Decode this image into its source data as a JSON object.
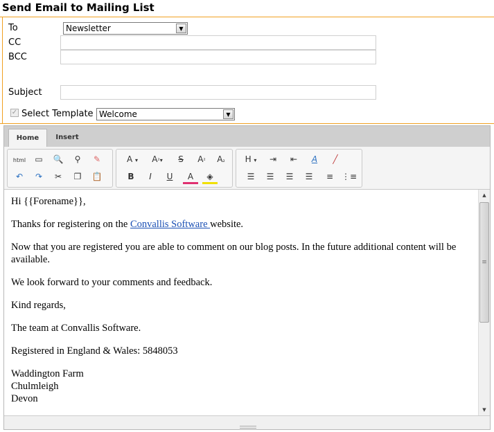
{
  "page": {
    "title": "Send Email to Mailing List"
  },
  "form": {
    "to_label": "To",
    "to_selected": "Newsletter",
    "cc_label": "CC",
    "bcc_label": "BCC",
    "subject_label": "Subject",
    "template_label": "Select Template",
    "template_checked": true,
    "template_selected": "Welcome"
  },
  "editor": {
    "tabs": [
      {
        "label": "Home",
        "active": true
      },
      {
        "label": "Insert",
        "active": false
      }
    ],
    "toolbar": {
      "html_mode": "html",
      "font_name": "A",
      "font_size": "A",
      "strike": "S",
      "superscript": "A",
      "subscript": "A",
      "heading": "H",
      "bold": "B",
      "italic": "I",
      "underline": "U",
      "font_color": "A"
    },
    "body": {
      "greeting": "Hi {{Forename}},",
      "line1_before": "Thanks for registering on the ",
      "line1_link": "Convallis Software ",
      "line1_after": "website.",
      "line2": "Now that you are registered you are able to comment on our blog posts. In the future additional content will be available.",
      "line3": "We look forward to your comments and feedback.",
      "line4": "Kind regards,",
      "line5": "The team at Convallis Software.",
      "line6": "Registered in England & Wales: 5848053",
      "address1": "Waddington Farm",
      "address2": "Chulmleigh",
      "address3": "Devon"
    }
  },
  "colors": {
    "accent": "#f0a020",
    "link": "#1a4fb4"
  }
}
